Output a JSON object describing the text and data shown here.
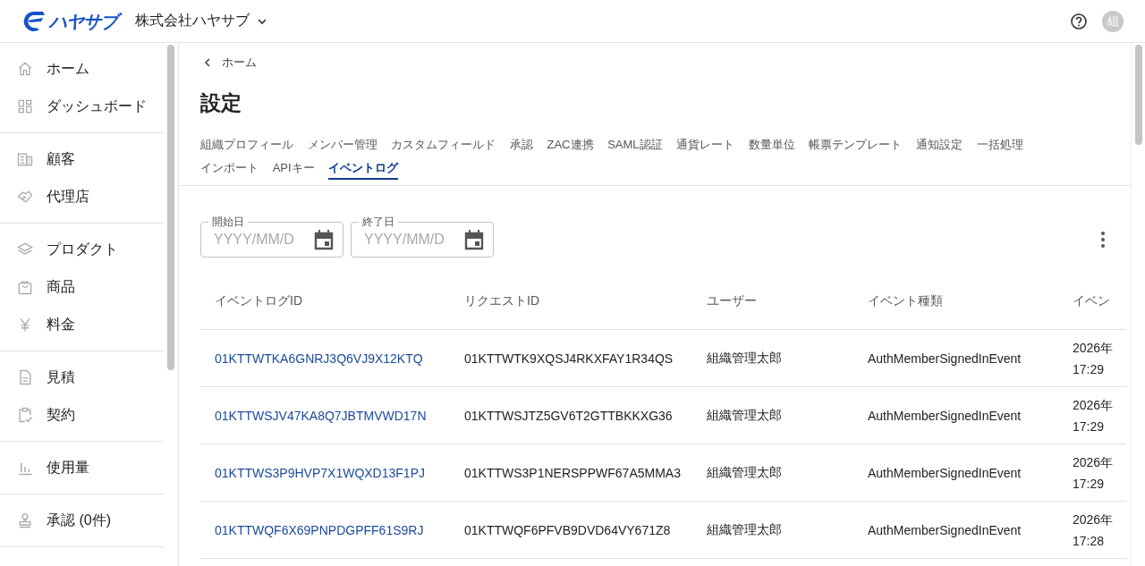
{
  "header": {
    "logo_text": "ハヤサブ",
    "company": "株式会社ハヤサブ",
    "avatar": "組"
  },
  "sidebar": {
    "groups": [
      {
        "items": [
          {
            "label": "ホーム"
          },
          {
            "label": "ダッシュボード"
          }
        ]
      },
      {
        "items": [
          {
            "label": "顧客"
          },
          {
            "label": "代理店"
          }
        ]
      },
      {
        "items": [
          {
            "label": "プロダクト"
          },
          {
            "label": "商品"
          },
          {
            "label": "料金"
          }
        ]
      },
      {
        "items": [
          {
            "label": "見積"
          },
          {
            "label": "契約"
          }
        ]
      },
      {
        "items": [
          {
            "label": "使用量"
          }
        ]
      },
      {
        "items": [
          {
            "label": "承認 (0件)"
          }
        ]
      }
    ]
  },
  "breadcrumb": "ホーム",
  "title": "設定",
  "tabs": [
    {
      "label": "組織プロフィール",
      "selected": false
    },
    {
      "label": "メンバー管理",
      "selected": false
    },
    {
      "label": "カスタムフィールド",
      "selected": false
    },
    {
      "label": "承認",
      "selected": false
    },
    {
      "label": "ZAC連携",
      "selected": false
    },
    {
      "label": "SAML認証",
      "selected": false
    },
    {
      "label": "通貨レート",
      "selected": false
    },
    {
      "label": "数量単位",
      "selected": false
    },
    {
      "label": "帳票テンプレート",
      "selected": false
    },
    {
      "label": "通知設定",
      "selected": false
    },
    {
      "label": "一括処理",
      "selected": false
    },
    {
      "label": "インポート",
      "selected": false
    },
    {
      "label": "APIキー",
      "selected": false
    },
    {
      "label": "イベントログ",
      "selected": true
    }
  ],
  "filters": [
    {
      "label": "開始日",
      "placeholder": "YYYY/MM/D"
    },
    {
      "label": "終了日",
      "placeholder": "YYYY/MM/D"
    }
  ],
  "table": {
    "columns": [
      "イベントログID",
      "リクエストID",
      "ユーザー",
      "イベント種類",
      "イベン"
    ],
    "rows": [
      [
        "01KTTWTKA6GNRJ3Q6VJ9X12KTQ",
        "01KTTWTK9XQSJ4RKXFAY1R34QS",
        "組織管理太郎",
        "AuthMemberSignedInEvent",
        "2026年 17:29"
      ],
      [
        "01KTTWSJV47KA8Q7JBTMVWD17N",
        "01KTTWSJTZ5GV6T2GTTBKKXG36",
        "組織管理太郎",
        "AuthMemberSignedInEvent",
        "2026年 17:29"
      ],
      [
        "01KTTWS3P9HVP7X1WQXD13F1PJ",
        "01KTTWS3P1NERSPPWF67A5MMA3",
        "組織管理太郎",
        "AuthMemberSignedInEvent",
        "2026年 17:29"
      ],
      [
        "01KTTWQF6X69PNPDGPFF61S9RJ",
        "01KTTWQF6PFVB9DVD64VY671Z8",
        "組織管理太郎",
        "AuthMemberSignedInEvent",
        "2026年 17:28"
      ]
    ]
  }
}
